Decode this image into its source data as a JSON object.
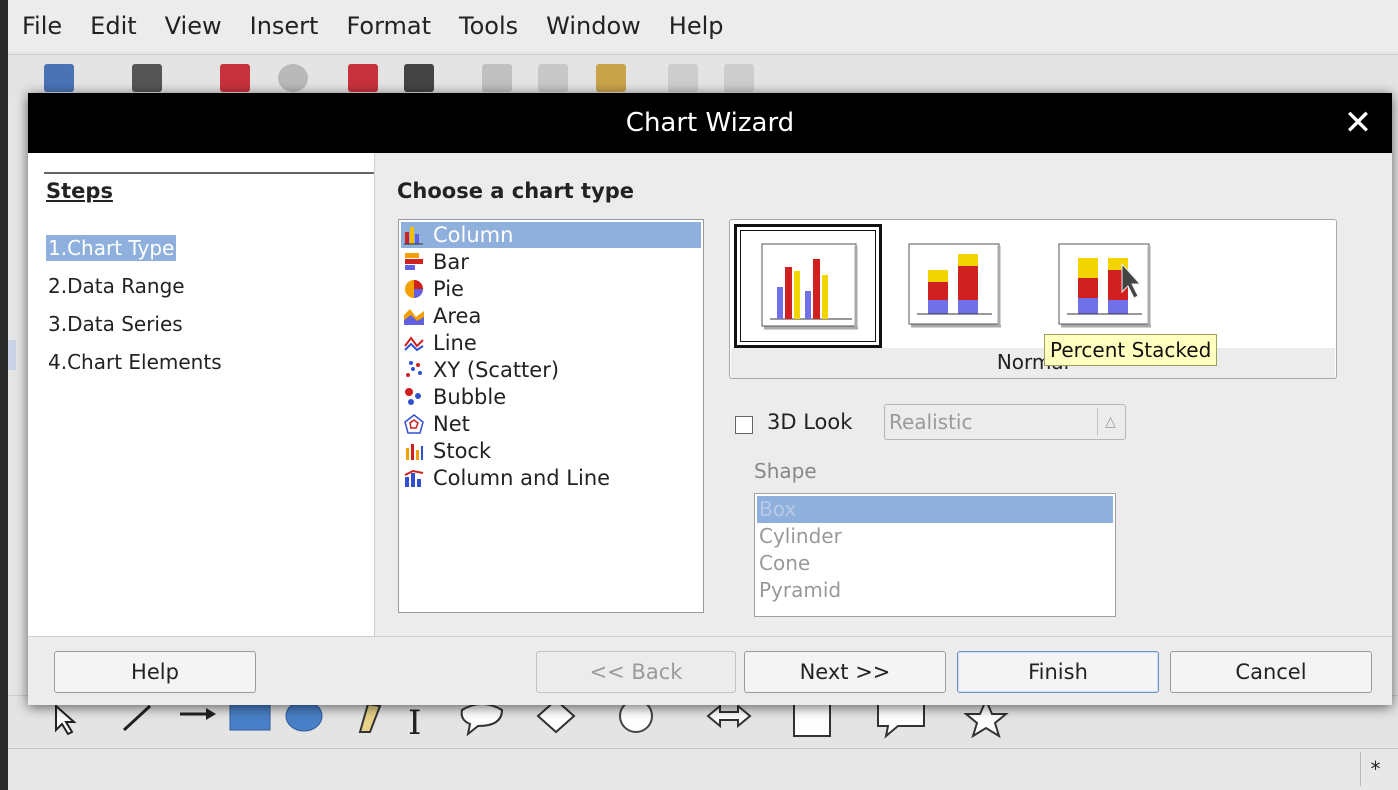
{
  "menubar": [
    "File",
    "Edit",
    "View",
    "Insert",
    "Format",
    "Tools",
    "Window",
    "Help"
  ],
  "dialog": {
    "title": "Chart Wizard",
    "close_symbol": "✕",
    "steps_title": "Steps",
    "steps": [
      "1.Chart Type",
      "2.Data Range",
      "3.Data Series",
      "4.Chart Elements"
    ],
    "heading": "Choose a chart type",
    "chart_types": [
      "Column",
      "Bar",
      "Pie",
      "Area",
      "Line",
      "XY (Scatter)",
      "Bubble",
      "Net",
      "Stock",
      "Column and Line"
    ],
    "variant_caption": "Normal",
    "tooltip": "Percent Stacked",
    "look_label": "3D Look",
    "look_select": "Realistic",
    "shape_label": "Shape",
    "shapes": [
      "Box",
      "Cylinder",
      "Cone",
      "Pyramid"
    ],
    "buttons": {
      "help": "Help",
      "back": "<< Back",
      "next": "Next >>",
      "finish": "Finish",
      "cancel": "Cancel"
    }
  },
  "statusbar": {
    "modified": "*"
  },
  "colors": {
    "selection": "#8fb0dd",
    "titlebar": "#000000",
    "tooltip": "#ffffbf"
  }
}
